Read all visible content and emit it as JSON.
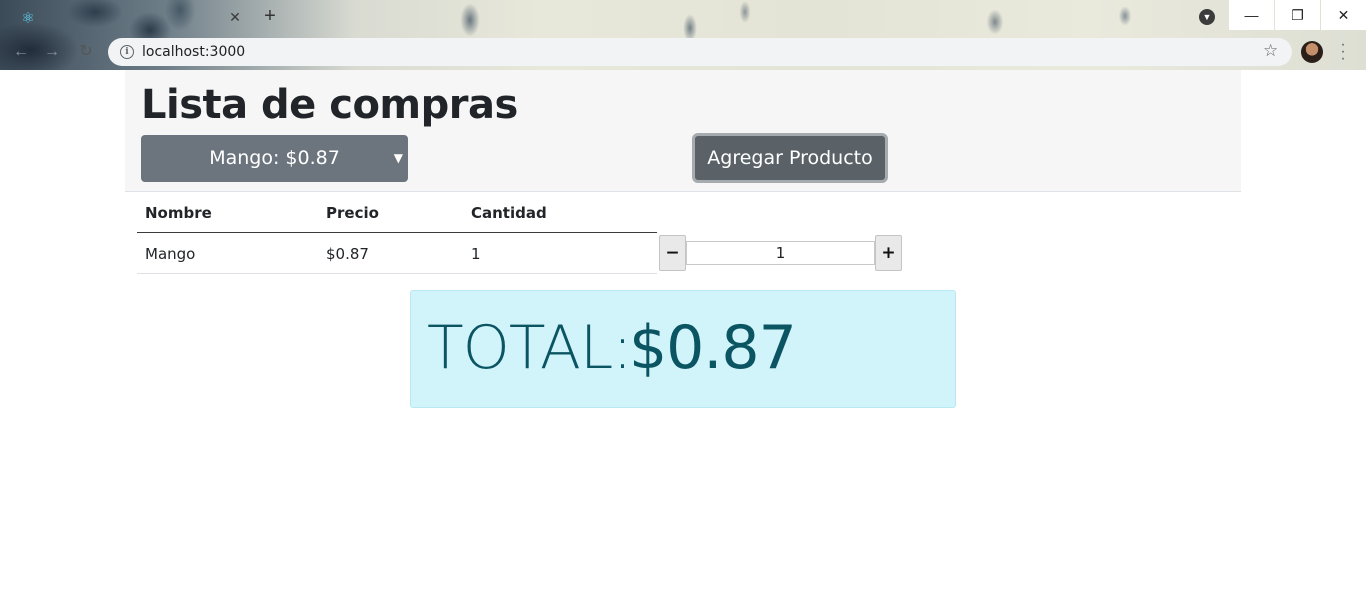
{
  "browser": {
    "tab": {
      "favicon_icon": "react-icon",
      "close_glyph": "✕"
    },
    "new_tab_glyph": "+",
    "url": "localhost:3000",
    "window_controls": {
      "minimize": "—",
      "maximize": "❐",
      "close": "✕"
    }
  },
  "header": {
    "title": "Lista de compras",
    "product_select": {
      "selected": "Mango: $0.87"
    },
    "add_button_label": "Agregar Producto"
  },
  "table": {
    "columns": [
      "Nombre",
      "Precio",
      "Cantidad"
    ],
    "rows": [
      {
        "nombre": "Mango",
        "precio": "$0.87",
        "cantidad": "1"
      }
    ]
  },
  "stepper": {
    "minus": "−",
    "plus": "+",
    "value": "1"
  },
  "total": {
    "label": "TOTAL:",
    "value": "$0.87"
  },
  "colors": {
    "select_bg": "#6c757d",
    "button_bg": "#5a6268",
    "total_bg": "#d1f3fa",
    "total_text": "#0b5563"
  }
}
